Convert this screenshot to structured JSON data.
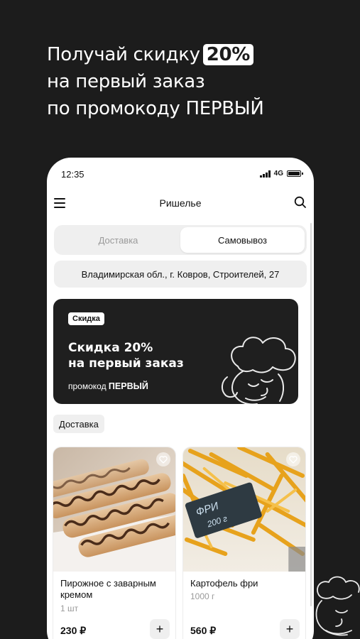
{
  "promo": {
    "line1": "Получай скидку",
    "percent": "20%",
    "line2": "на первый заказ",
    "line3": "по промокоду ПЕРВЫЙ"
  },
  "status_bar": {
    "time": "12:35",
    "network": "4G"
  },
  "header": {
    "title": "Ришелье",
    "menu_icon": "hamburger-menu-icon",
    "search_icon": "search-icon"
  },
  "delivery_toggle": {
    "options": [
      "Доставка",
      "Самовывоз"
    ],
    "selected": "Самовывоз"
  },
  "address": "Владимирская обл., г. Ковров, Строителей, 27",
  "banner": {
    "badge": "Скидка",
    "title_line1": "Скидка 20%",
    "title_line2": "на первый заказ",
    "code_prefix": "промокод",
    "code": "ПЕРВЫЙ"
  },
  "category_chip": "Доставка",
  "products": [
    {
      "name": "Пирожное с заварным кремом",
      "weight": "1 шт",
      "price": "230 ₽",
      "add_label": "+"
    },
    {
      "name": "Картофель фри",
      "weight": "1000 г",
      "price": "560 ₽",
      "add_label": "+"
    }
  ],
  "colors": {
    "background": "#1c1c1c",
    "banner": "#1f1f1f",
    "surface": "#efefef",
    "text": "#111111",
    "muted": "#9a9a9a"
  }
}
